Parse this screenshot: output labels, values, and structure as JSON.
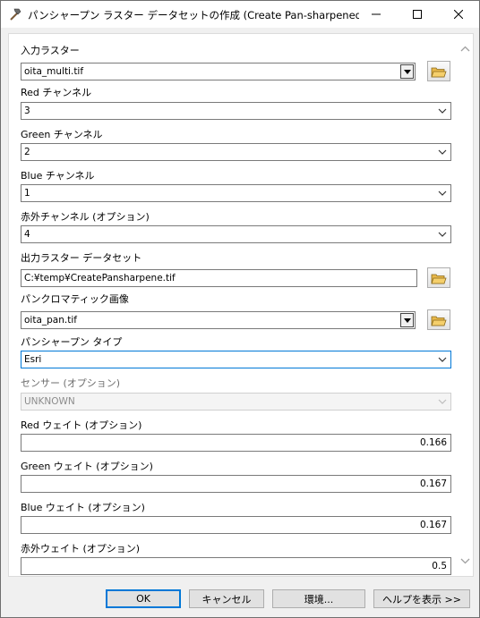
{
  "window": {
    "title": "パンシャープン ラスター データセットの作成 (Create Pan-sharpened Raster ..."
  },
  "form": {
    "input_raster": {
      "label": "入力ラスター",
      "value": "oita_multi.tif"
    },
    "red_channel": {
      "label": "Red チャンネル",
      "value": "3"
    },
    "green_channel": {
      "label": "Green チャンネル",
      "value": "2"
    },
    "blue_channel": {
      "label": "Blue チャンネル",
      "value": "1"
    },
    "infrared_channel": {
      "label": "赤外チャンネル (オプション)",
      "value": "4"
    },
    "output_raster": {
      "label": "出力ラスター データセット",
      "value": "C:¥temp¥CreatePansharpene.tif"
    },
    "pan_image": {
      "label": "パンクロマティック画像",
      "value": "oita_pan.tif"
    },
    "pansharpen_type": {
      "label": "パンシャープン タイプ",
      "value": "Esri"
    },
    "sensor": {
      "label": "センサー (オプション)",
      "value": "UNKNOWN"
    },
    "red_weight": {
      "label": "Red ウェイト (オプション)",
      "value": "0.166"
    },
    "green_weight": {
      "label": "Green ウェイト (オプション)",
      "value": "0.167"
    },
    "blue_weight": {
      "label": "Blue ウェイト (オプション)",
      "value": "0.167"
    },
    "infrared_weight": {
      "label": "赤外ウェイト (オプション)",
      "value": "0.5"
    }
  },
  "footer": {
    "ok_label": "OK",
    "cancel_label": "キャンセル",
    "environments_label": "環境...",
    "help_label": "ヘルプを表示 >>"
  },
  "colors": {
    "focus_border": "#0078d7",
    "folder_icon": "#e8b84a"
  }
}
